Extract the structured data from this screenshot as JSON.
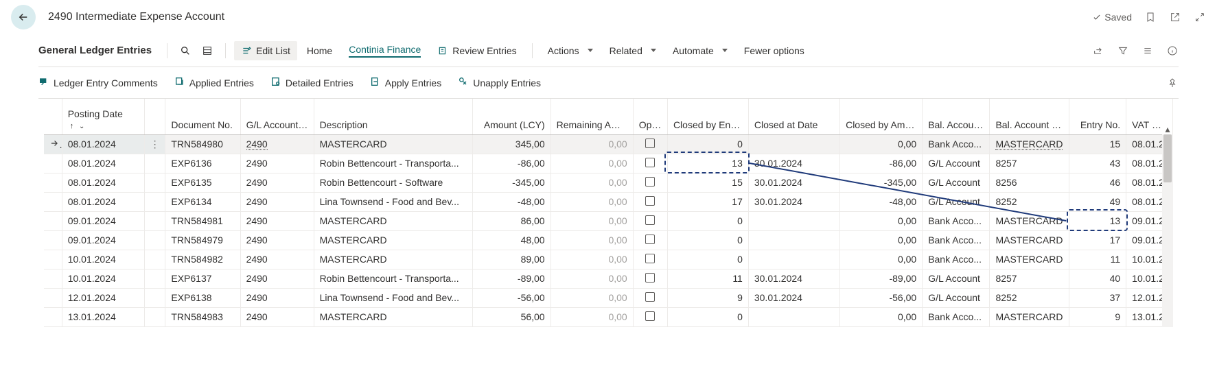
{
  "header": {
    "title": "2490 Intermediate Expense Account",
    "saved_label": "Saved"
  },
  "toolbar": {
    "title": "General Ledger Entries",
    "edit_list": "Edit List",
    "home": "Home",
    "continia": "Continia Finance",
    "review": "Review Entries",
    "actions": "Actions",
    "related": "Related",
    "automate": "Automate",
    "fewer": "Fewer options"
  },
  "subbar": {
    "comments": "Ledger Entry Comments",
    "applied": "Applied Entries",
    "detailed": "Detailed Entries",
    "apply": "Apply Entries",
    "unapply": "Unapply Entries"
  },
  "columns": {
    "posting_date": "Posting Date",
    "document_no": "Document No.",
    "gl_account_no": "G/L Account No.",
    "description": "Description",
    "amount_lcy": "Amount (LCY)",
    "remaining_amount": "Remaining Amount",
    "open": "Open",
    "closed_by_entry": "Closed by Entry No.",
    "closed_at_date": "Closed at Date",
    "closed_by_amount": "Closed by Amount",
    "bal_account_type": "Bal. Account Type",
    "bal_account_no": "Bal. Account No.",
    "entry_no": "Entry No.",
    "vat_date": "VAT Date"
  },
  "rows": [
    {
      "posting": "08.01.2024",
      "doc": "TRN584980",
      "gl": "2490",
      "desc": "MASTERCARD",
      "amount": "345,00",
      "remain": "0,00",
      "closed_by": "0",
      "closed_at": "",
      "closed_amt": "0,00",
      "btype": "Bank Acco...",
      "bno": "MASTERCARD",
      "entry": "15",
      "vat": "08.01.2",
      "sel": true,
      "bno_link": true,
      "gl_link": true
    },
    {
      "posting": "08.01.2024",
      "doc": "EXP6136",
      "gl": "2490",
      "desc": "Robin Bettencourt - Transporta...",
      "amount": "-86,00",
      "remain": "0,00",
      "closed_by": "13",
      "closed_at": "30.01.2024",
      "closed_amt": "-86,00",
      "btype": "G/L Account",
      "bno": "8257",
      "entry": "43",
      "vat": "08.01.2"
    },
    {
      "posting": "08.01.2024",
      "doc": "EXP6135",
      "gl": "2490",
      "desc": "Robin Bettencourt - Software",
      "amount": "-345,00",
      "remain": "0,00",
      "closed_by": "15",
      "closed_at": "30.01.2024",
      "closed_amt": "-345,00",
      "btype": "G/L Account",
      "bno": "8256",
      "entry": "46",
      "vat": "08.01.2"
    },
    {
      "posting": "08.01.2024",
      "doc": "EXP6134",
      "gl": "2490",
      "desc": "Lina Townsend - Food and Bev...",
      "amount": "-48,00",
      "remain": "0,00",
      "closed_by": "17",
      "closed_at": "30.01.2024",
      "closed_amt": "-48,00",
      "btype": "G/L Account",
      "bno": "8252",
      "entry": "49",
      "vat": "08.01.2"
    },
    {
      "posting": "09.01.2024",
      "doc": "TRN584981",
      "gl": "2490",
      "desc": "MASTERCARD",
      "amount": "86,00",
      "remain": "0,00",
      "closed_by": "0",
      "closed_at": "",
      "closed_amt": "0,00",
      "btype": "Bank Acco...",
      "bno": "MASTERCARD",
      "entry": "13",
      "vat": "09.01.2"
    },
    {
      "posting": "09.01.2024",
      "doc": "TRN584979",
      "gl": "2490",
      "desc": "MASTERCARD",
      "amount": "48,00",
      "remain": "0,00",
      "closed_by": "0",
      "closed_at": "",
      "closed_amt": "0,00",
      "btype": "Bank Acco...",
      "bno": "MASTERCARD",
      "entry": "17",
      "vat": "09.01.2"
    },
    {
      "posting": "10.01.2024",
      "doc": "TRN584982",
      "gl": "2490",
      "desc": "MASTERCARD",
      "amount": "89,00",
      "remain": "0,00",
      "closed_by": "0",
      "closed_at": "",
      "closed_amt": "0,00",
      "btype": "Bank Acco...",
      "bno": "MASTERCARD",
      "entry": "11",
      "vat": "10.01.2"
    },
    {
      "posting": "10.01.2024",
      "doc": "EXP6137",
      "gl": "2490",
      "desc": "Robin Bettencourt - Transporta...",
      "amount": "-89,00",
      "remain": "0,00",
      "closed_by": "11",
      "closed_at": "30.01.2024",
      "closed_amt": "-89,00",
      "btype": "G/L Account",
      "bno": "8257",
      "entry": "40",
      "vat": "10.01.2"
    },
    {
      "posting": "12.01.2024",
      "doc": "EXP6138",
      "gl": "2490",
      "desc": "Lina Townsend - Food and Bev...",
      "amount": "-56,00",
      "remain": "0,00",
      "closed_by": "9",
      "closed_at": "30.01.2024",
      "closed_amt": "-56,00",
      "btype": "G/L Account",
      "bno": "8252",
      "entry": "37",
      "vat": "12.01.2"
    },
    {
      "posting": "13.01.2024",
      "doc": "TRN584983",
      "gl": "2490",
      "desc": "MASTERCARD",
      "amount": "56,00",
      "remain": "0,00",
      "closed_by": "0",
      "closed_at": "",
      "closed_amt": "0,00",
      "btype": "Bank Acco...",
      "bno": "MASTERCARD",
      "entry": "9",
      "vat": "13.01.2"
    }
  ]
}
